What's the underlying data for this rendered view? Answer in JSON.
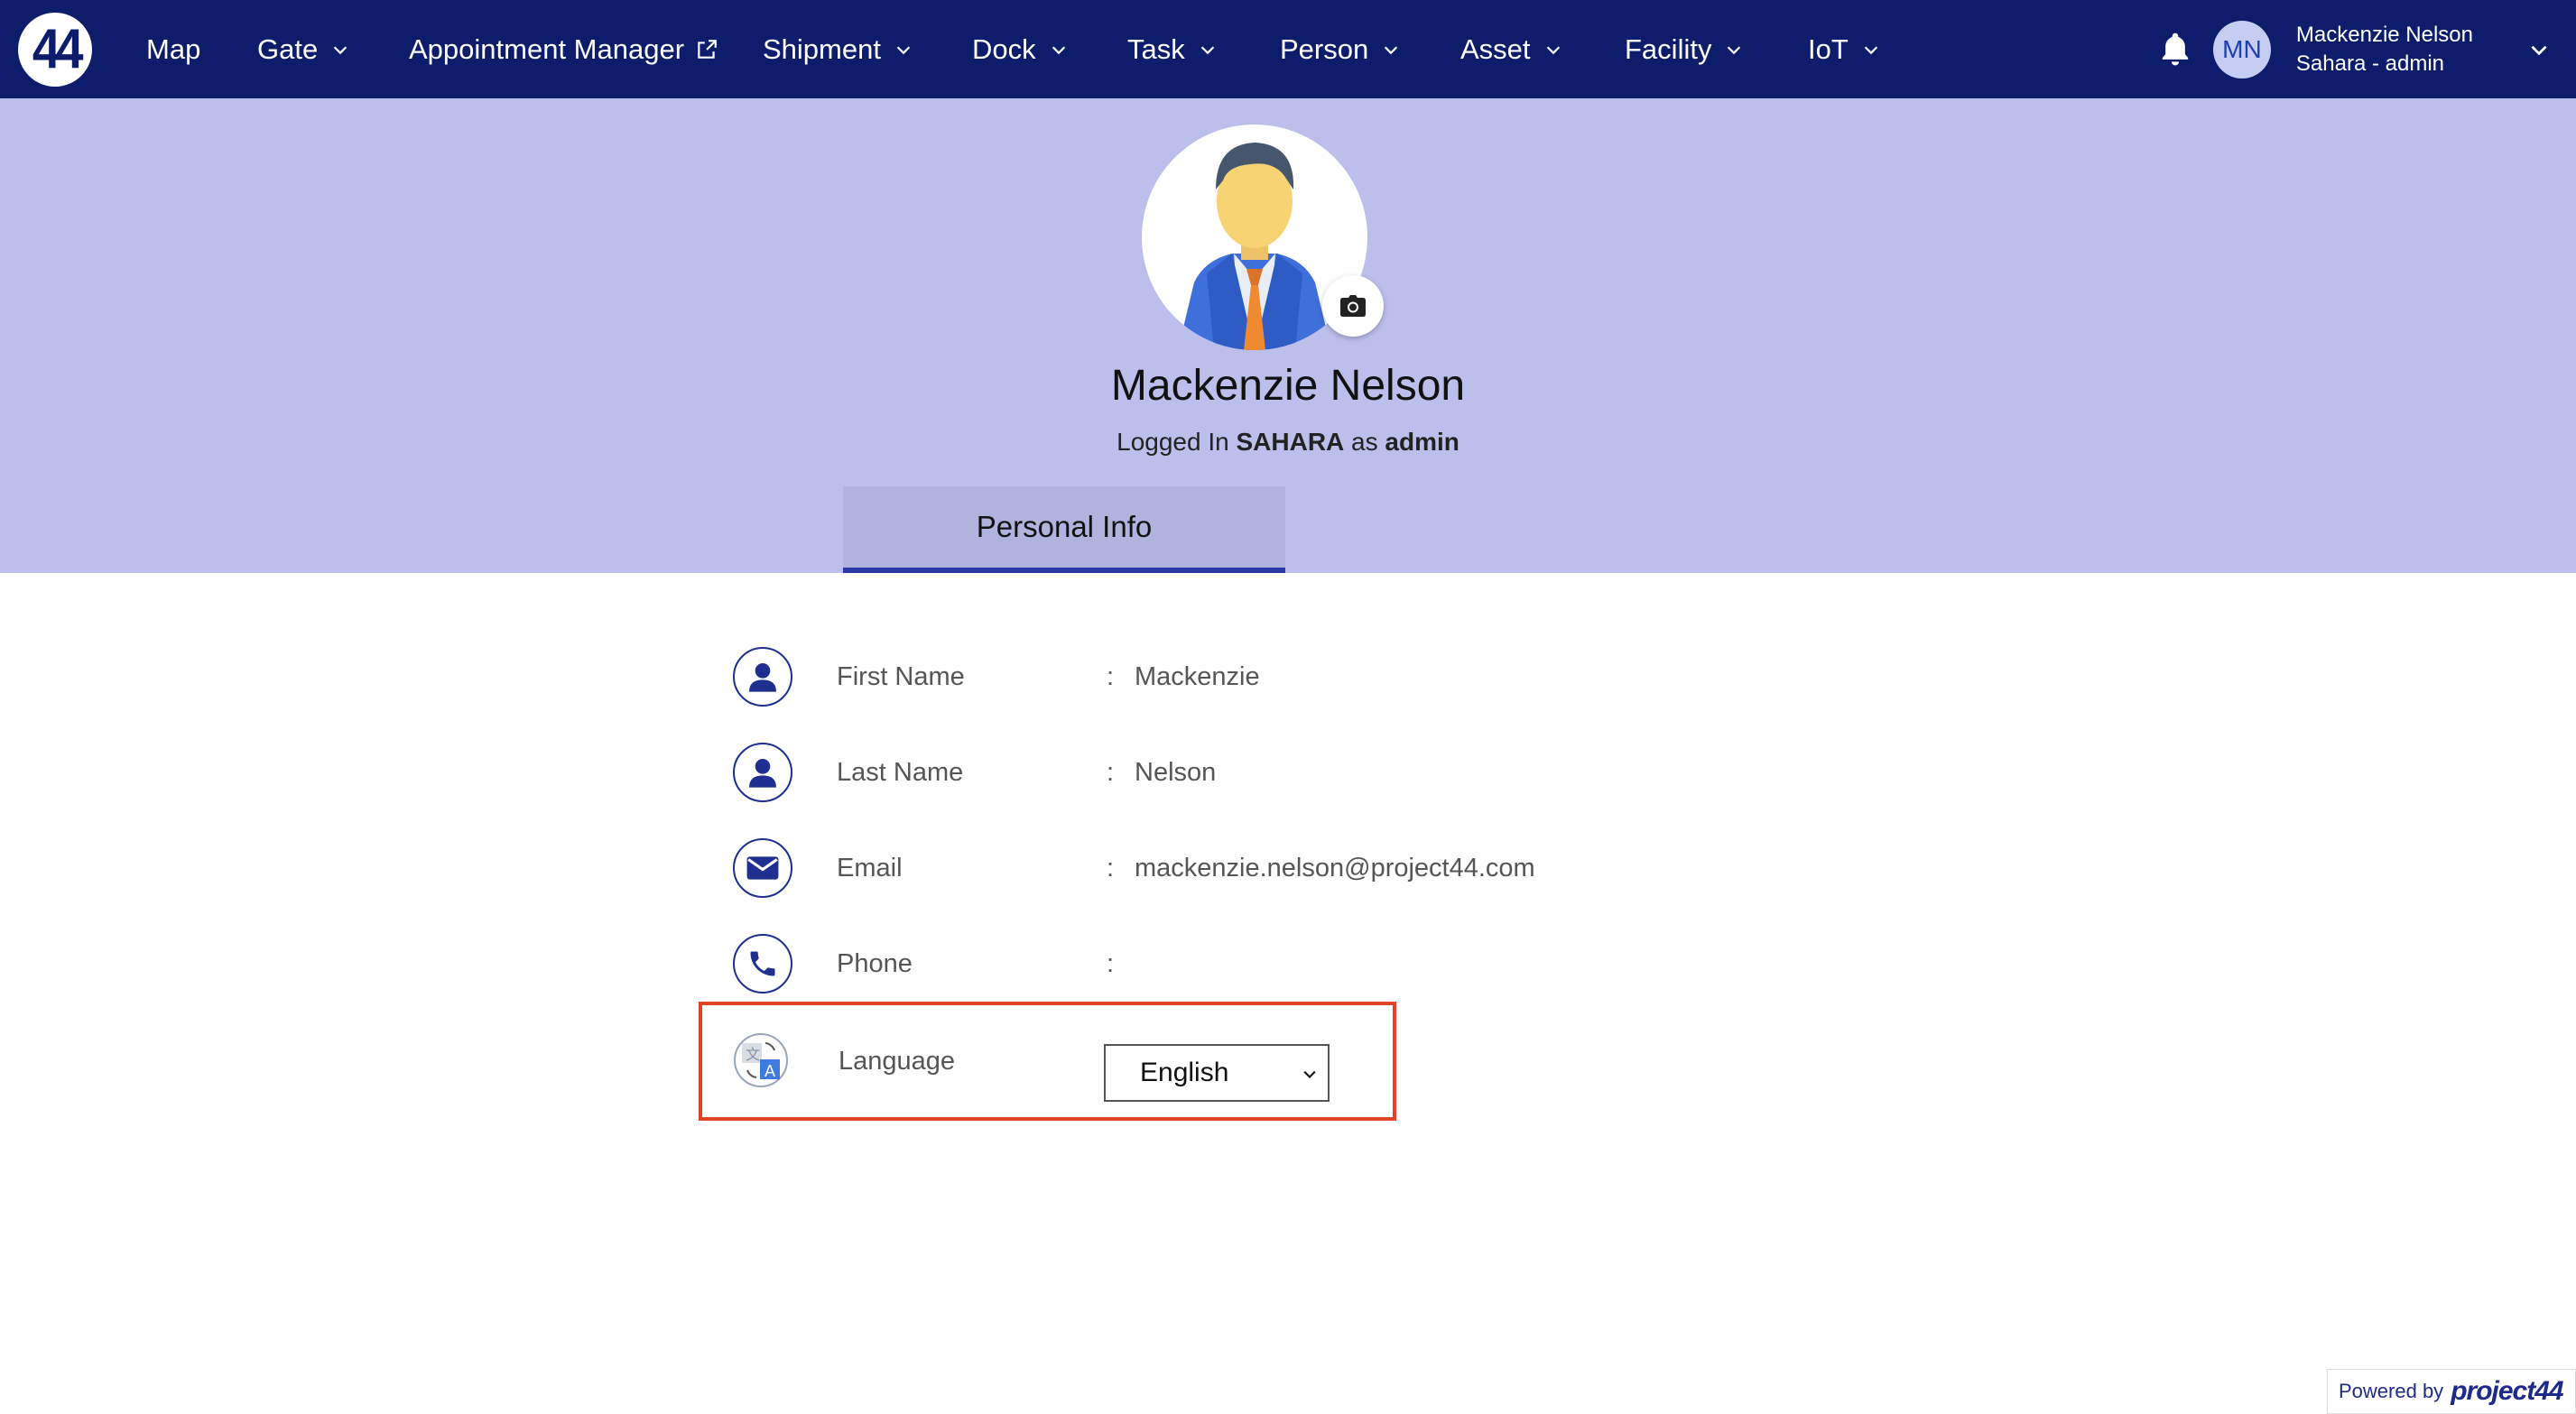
{
  "navbar": {
    "logo_text": "44",
    "items": [
      {
        "label": "Map",
        "dropdown": false
      },
      {
        "label": "Gate",
        "dropdown": true
      },
      {
        "label": "Appointment Manager",
        "dropdown": false,
        "external": true
      },
      {
        "label": "Shipment",
        "dropdown": true
      },
      {
        "label": "Dock",
        "dropdown": true
      },
      {
        "label": "Task",
        "dropdown": true
      },
      {
        "label": "Person",
        "dropdown": true
      },
      {
        "label": "Asset",
        "dropdown": true
      },
      {
        "label": "Facility",
        "dropdown": true
      },
      {
        "label": "IoT",
        "dropdown": true
      }
    ],
    "user_initials": "MN",
    "user_name": "Mackenzie Nelson",
    "user_role": "Sahara - admin"
  },
  "profile": {
    "name": "Mackenzie Nelson",
    "logged_in_prefix": "Logged In",
    "org": "SAHARA",
    "as_word": "as",
    "role": "admin",
    "tab_label": "Personal Info"
  },
  "info": {
    "colon": ":",
    "first_name_label": "First Name",
    "first_name_value": "Mackenzie",
    "last_name_label": "Last Name",
    "last_name_value": "Nelson",
    "email_label": "Email",
    "email_value": "mackenzie.nelson@project44.com",
    "phone_label": "Phone",
    "phone_value": "",
    "language_label": "Language",
    "language_value": "English"
  },
  "footer": {
    "powered_by": "Powered by",
    "brand": "project44"
  },
  "colors": {
    "navbar": "#0d1c6b",
    "band": "#bcbfeb",
    "tab_active": "#2a3aa8",
    "highlight": "#e0442a"
  }
}
